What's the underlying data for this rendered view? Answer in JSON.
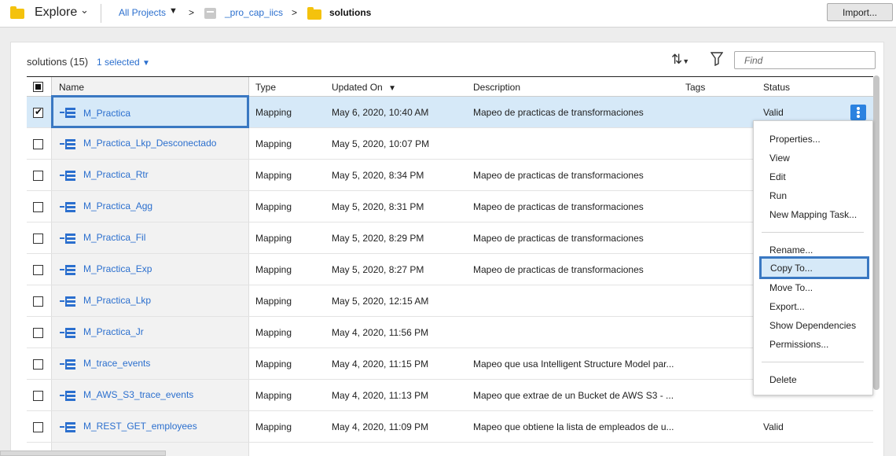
{
  "topbar": {
    "explore_label": "Explore",
    "breadcrumb_all": "All Projects",
    "breadcrumb_sep": ">",
    "breadcrumb_project": "_pro_cap_iics",
    "breadcrumb_folder": "solutions",
    "import_label": "Import..."
  },
  "toolbar": {
    "solutions_count": "solutions (15)",
    "selected_count": "1 selected",
    "find_placeholder": "Find"
  },
  "table": {
    "headers": {
      "name": "Name",
      "type": "Type",
      "updated_on": "Updated On",
      "description": "Description",
      "tags": "Tags",
      "status": "Status"
    },
    "rows": [
      {
        "name": "M_Practica",
        "type": "Mapping",
        "updated": "May 6, 2020, 10:40 AM",
        "description": "Mapeo de practicas de transformaciones",
        "status": "Valid",
        "checked": true
      },
      {
        "name": "M_Practica_Lkp_Desconectado",
        "type": "Mapping",
        "updated": "May 5, 2020, 10:07 PM",
        "description": "",
        "status": ""
      },
      {
        "name": "M_Practica_Rtr",
        "type": "Mapping",
        "updated": "May 5, 2020, 8:34 PM",
        "description": "Mapeo de practicas de transformaciones",
        "status": ""
      },
      {
        "name": "M_Practica_Agg",
        "type": "Mapping",
        "updated": "May 5, 2020, 8:31 PM",
        "description": "Mapeo de practicas de transformaciones",
        "status": ""
      },
      {
        "name": "M_Practica_Fil",
        "type": "Mapping",
        "updated": "May 5, 2020, 8:29 PM",
        "description": "Mapeo de practicas de transformaciones",
        "status": ""
      },
      {
        "name": "M_Practica_Exp",
        "type": "Mapping",
        "updated": "May 5, 2020, 8:27 PM",
        "description": "Mapeo de practicas de transformaciones",
        "status": ""
      },
      {
        "name": "M_Practica_Lkp",
        "type": "Mapping",
        "updated": "May 5, 2020, 12:15 AM",
        "description": "",
        "status": ""
      },
      {
        "name": "M_Practica_Jr",
        "type": "Mapping",
        "updated": "May 4, 2020, 11:56 PM",
        "description": "",
        "status": ""
      },
      {
        "name": "M_trace_events",
        "type": "Mapping",
        "updated": "May 4, 2020, 11:15 PM",
        "description": "Mapeo que usa Intelligent Structure Model par...",
        "status": ""
      },
      {
        "name": "M_AWS_S3_trace_events",
        "type": "Mapping",
        "updated": "May 4, 2020, 11:13 PM",
        "description": "Mapeo que extrae de un Bucket de AWS S3 - ...",
        "status": ""
      },
      {
        "name": "M_REST_GET_employees",
        "type": "Mapping",
        "updated": "May 4, 2020, 11:09 PM",
        "description": "Mapeo que obtiene la lista de empleados de u...",
        "status": "Valid"
      }
    ]
  },
  "context_menu": {
    "items": [
      "Properties...",
      "View",
      "Edit",
      "Run",
      "New Mapping Task..."
    ],
    "rename": "Rename...",
    "copy_to": "Copy To...",
    "items2": [
      "Move To...",
      "Export...",
      "Show Dependencies",
      "Permissions..."
    ],
    "delete": "Delete"
  },
  "icons": {
    "folder": "folder-icon",
    "project": "project-icon",
    "mapping": "mapping-icon",
    "sort": "sort-icon",
    "filter": "filter-icon",
    "kebab": "kebab-icon"
  },
  "colors": {
    "link": "#2b6fce",
    "selection_border": "#3a78c2",
    "selection_bg": "#d6e9f8",
    "folder": "#f4c20d"
  }
}
